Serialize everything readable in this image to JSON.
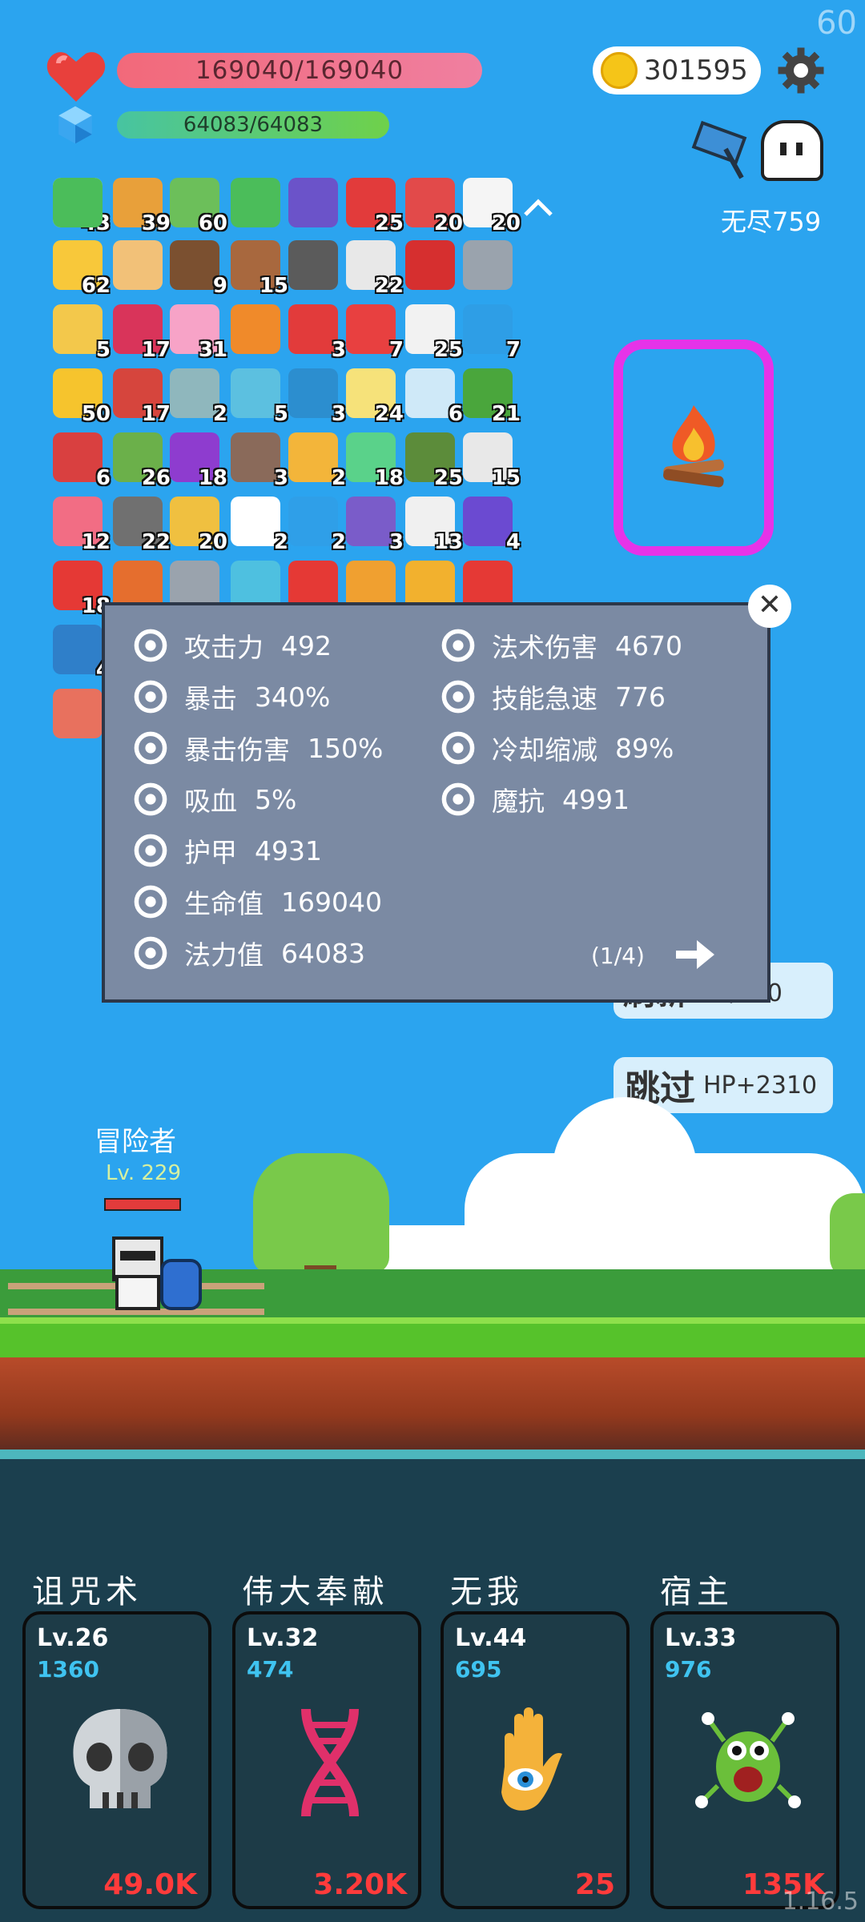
{
  "fps": "60",
  "hp": {
    "text": "169040/169040"
  },
  "mp": {
    "text": "64083/64083"
  },
  "gold": "301595",
  "endless": "无尽759",
  "items": [
    {
      "c": "#f0f0f0",
      "n": "43"
    },
    {
      "c": "#e8a03a",
      "n": "39"
    },
    {
      "c": "#6cbf5a",
      "n": "60"
    },
    {
      "c": "#4bbd5a",
      "n": ""
    },
    {
      "c": "#6b53c9",
      "n": ""
    },
    {
      "c": "#e23b3b",
      "n": "25"
    },
    {
      "c": "#e24a4a",
      "n": "20"
    },
    {
      "c": "#f5f5f5",
      "n": "20"
    },
    {
      "c": "#f8c83a",
      "n": "62"
    },
    {
      "c": "#f2c178",
      "n": ""
    },
    {
      "c": "#7b5030",
      "n": "9"
    },
    {
      "c": "#a8683e",
      "n": "15"
    },
    {
      "c": "#5b5b5b",
      "n": ""
    },
    {
      "c": "#e8e8e8",
      "n": "22"
    },
    {
      "c": "#d62f2f",
      "n": ""
    },
    {
      "c": "#9aa3ad",
      "n": ""
    },
    {
      "c": "#f3c84b",
      "n": "5"
    },
    {
      "c": "#d9345a",
      "n": "17"
    },
    {
      "c": "#f7a3c7",
      "n": "31"
    },
    {
      "c": "#f08a2a",
      "n": ""
    },
    {
      "c": "#e23b3b",
      "n": "3"
    },
    {
      "c": "#e84040",
      "n": "7"
    },
    {
      "c": "#f2f2f2",
      "n": "25"
    },
    {
      "c": "#2e9ee6",
      "n": "7"
    },
    {
      "c": "#f6c42d",
      "n": "50"
    },
    {
      "c": "#d6453d",
      "n": "17"
    },
    {
      "c": "#8fb7bd",
      "n": "2"
    },
    {
      "c": "#5cc0e0",
      "n": "5"
    },
    {
      "c": "#2c8ecf",
      "n": "3"
    },
    {
      "c": "#f6e27a",
      "n": "24"
    },
    {
      "c": "#cfe9f8",
      "n": "6"
    },
    {
      "c": "#4aa63c",
      "n": "21"
    },
    {
      "c": "#d94040",
      "n": "6"
    },
    {
      "c": "#6bb04a",
      "n": "26"
    },
    {
      "c": "#8e3ccf",
      "n": "18"
    },
    {
      "c": "#8a6a5a",
      "n": "3"
    },
    {
      "c": "#f3b53a",
      "n": "2"
    },
    {
      "c": "#5ad28a",
      "n": "18"
    },
    {
      "c": "#5c8c3a",
      "n": "25"
    },
    {
      "c": "#e8e8e8",
      "n": "15"
    },
    {
      "c": "#f26d84",
      "n": "12"
    },
    {
      "c": "#707070",
      "n": "22"
    },
    {
      "c": "#f0c040",
      "n": "20"
    },
    {
      "c": "#ffffff",
      "n": "2"
    },
    {
      "c": "#2f9fe8",
      "n": "2"
    },
    {
      "c": "#7a5cc9",
      "n": "3"
    },
    {
      "c": "#f0f0f0",
      "n": "13"
    },
    {
      "c": "#6b4ad1",
      "n": "4"
    },
    {
      "c": "#e53935",
      "n": "18"
    },
    {
      "c": "#e56e2e",
      "n": ""
    },
    {
      "c": "#9aa3ad",
      "n": ""
    },
    {
      "c": "#4ec0e0",
      "n": ""
    },
    {
      "c": "#e53935",
      "n": ""
    },
    {
      "c": "#f0a030",
      "n": ""
    },
    {
      "c": "#f2b12e",
      "n": ""
    },
    {
      "c": "#e53935",
      "n": ""
    },
    {
      "c": "#2f7fc9",
      "n": "4"
    },
    {
      "c": "#e8715e",
      "n": ""
    },
    {
      "c": "#4bbd5a",
      "n": ""
    }
  ],
  "stats": {
    "left": [
      {
        "icon": "axe-icon",
        "label": "攻击力",
        "value": "492"
      },
      {
        "icon": "crossed-swords-icon",
        "label": "暴击",
        "value": "340%"
      },
      {
        "icon": "crit-damage-icon",
        "label": "暴击伤害",
        "value": "150%"
      },
      {
        "icon": "skull-horns-icon",
        "label": "吸血",
        "value": "5%"
      },
      {
        "icon": "shield-icon",
        "label": "护甲",
        "value": "4931"
      },
      {
        "icon": "heart-icon",
        "label": "生命值",
        "value": "169040"
      },
      {
        "icon": "gem-icon",
        "label": "法力值",
        "value": "64083"
      }
    ],
    "right": [
      {
        "icon": "sun-icon",
        "label": "法术伤害",
        "value": "4670"
      },
      {
        "icon": "lightning-icon",
        "label": "技能急速",
        "value": "776"
      },
      {
        "icon": "hourglass-icon",
        "label": "冷却缩减",
        "value": "89%"
      },
      {
        "icon": "magic-shield-icon",
        "label": "魔抗",
        "value": "4991"
      }
    ],
    "pager": "(1/4)"
  },
  "refresh": {
    "label": "刷新",
    "sub": "金币-10"
  },
  "skip": {
    "label": "跳过",
    "sub": "HP+2310"
  },
  "hero": {
    "name": "冒险者",
    "level": "Lv. 229"
  },
  "skills": [
    {
      "title": "诅咒术",
      "level": "Lv.26",
      "num": "1360",
      "cost": "49.0K",
      "icon": "skull-icon"
    },
    {
      "title": "伟大奉献",
      "level": "Lv.32",
      "num": "474",
      "cost": "3.20K",
      "icon": "dna-icon"
    },
    {
      "title": "无我",
      "level": "Lv.44",
      "num": "695",
      "cost": "25",
      "icon": "hand-eye-icon"
    },
    {
      "title": "宿主",
      "level": "Lv.33",
      "num": "976",
      "cost": "135K",
      "icon": "monster-icon"
    }
  ],
  "version": "1.16.5"
}
